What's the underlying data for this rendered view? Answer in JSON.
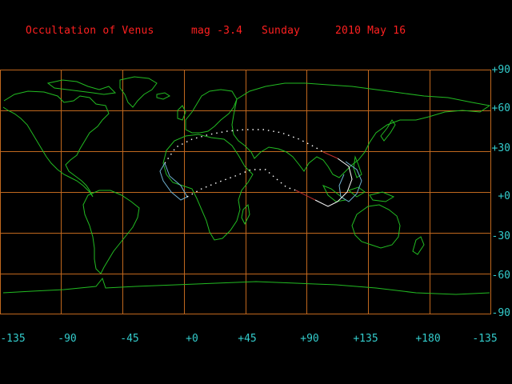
{
  "header": {
    "event": "Occultation of Venus",
    "magnitude": "mag -3.4",
    "weekday": "Sunday",
    "date": "2010 May 16"
  },
  "axes": {
    "lat_labels": [
      "+90",
      "+60",
      "+30",
      "+0",
      "-30",
      "-60",
      "-90"
    ],
    "lon_labels": [
      "-135",
      "-90",
      "-45",
      "+0",
      "+45",
      "+90",
      "+135",
      "+180",
      "-135"
    ]
  },
  "colors": {
    "background": "#000000",
    "title": "#ff2020",
    "grid": "#c0681e",
    "labels": "#33cccc",
    "coastline": "#22bb22",
    "path_dotted": "#ffffff",
    "limit_white": "#ffffff",
    "limit_cyan": "#6fb0d0",
    "limit_red": "#c03030"
  }
}
